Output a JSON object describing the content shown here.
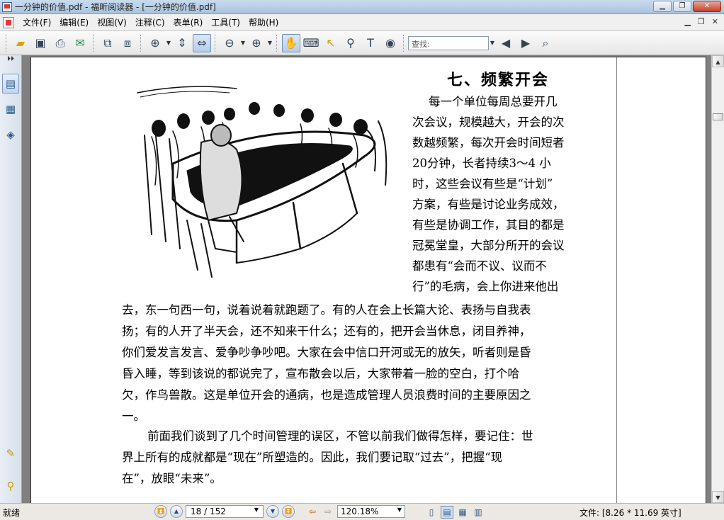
{
  "window": {
    "title": "一分钟的价值.pdf - 福昕阅读器 - [一分钟的价值.pdf]"
  },
  "menu": {
    "items": [
      "文件(F)",
      "编辑(E)",
      "视图(V)",
      "注释(C)",
      "表单(R)",
      "工具(T)",
      "帮助(H)"
    ]
  },
  "toolbar": {
    "find_placeholder": "查找:",
    "icons": [
      "open-icon",
      "save-icon",
      "print-icon",
      "email-icon",
      "extract-icon",
      "export-icon",
      "zoom-in-icon",
      "fit-page-icon",
      "fit-width-icon",
      "zoom-out-icon",
      "zoom-plus-icon",
      "hand-icon",
      "text-select-icon",
      "select-icon",
      "binoculars-icon",
      "typewriter-icon",
      "snapshot-icon",
      "prev-result-icon",
      "next-result-icon",
      "search-icon"
    ]
  },
  "document": {
    "heading": "七、频繁开会",
    "lines": [
      "每一个单位每周总要开几",
      "次会议，规模越大，开会的次",
      "数越频繁，每次开会时间短者",
      "20分钟，长者持续3～4 小",
      "时，这些会议有些是“计划”",
      "方案，有些是讨论业务成效，",
      "有些是协调工作，其目的都是",
      "冠冕堂皇，大部分所开的会议",
      "都患有“会而不议、议而不",
      "行”的毛病，会上你进来他出",
      "去，东一句西一句，说着说着就跑题了。有的人在会上长篇大论、表扬与自我表",
      "扬；有的人开了半天会，还不知来干什么；还有的，把开会当休息，闭目养神，",
      "你们爱发言发言、爱争吵争吵吧。大家在会中信口开河或无的放矢，听者则是昏",
      "昏入睡，等到该说的都说完了，宣布散会以后，大家带着一脸的空白，打个哈",
      "欠，作鸟兽散。这是单位开会的通病，也是造成管理人员浪费时间的主要原因之",
      "一。",
      "前面我们谈到了几个时间管理的误区，不管以前我们做得怎样，要记住：世",
      "界上所有的成就都是“现在”所塑造的。因此，我们要记取“过去”，把握“现",
      "在”，放眼“未来”。"
    ]
  },
  "status": {
    "ready": "就绪",
    "page": "18 / 152",
    "zoom": "120.18%",
    "size": "文件: [8.26 * 11.69 英寸]"
  }
}
